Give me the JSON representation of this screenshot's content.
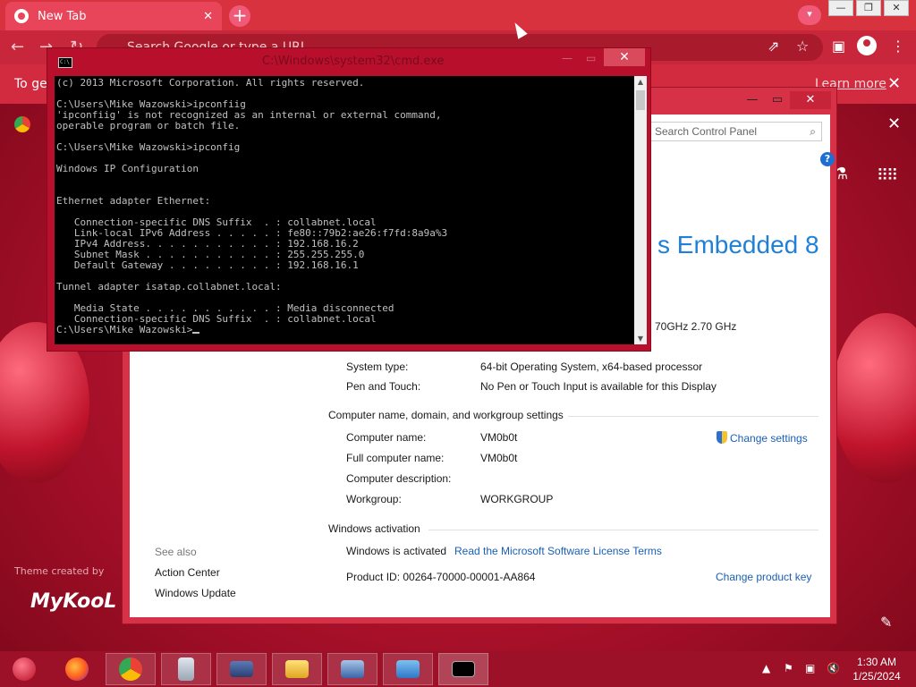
{
  "browser": {
    "tab_title": "New Tab",
    "tab_close": "✕",
    "new_tab": "+",
    "omnibox_placeholder": "Search Google or type a URL",
    "infobar_text": "To get",
    "learn_more": "Learn more",
    "close_glyph": "✕",
    "theme_credit": "Theme created by",
    "brand_text": "MyKooL"
  },
  "syswin": {
    "search_placeholder": "Search Control Panel",
    "help": "?",
    "edition": "s Embedded 8",
    "cpu": "70GHz   2.70 GHz",
    "rows_system": [
      {
        "label": "System type:",
        "value": "64-bit Operating System, x64-based processor"
      },
      {
        "label": "Pen and Touch:",
        "value": "No Pen or Touch Input is available for this Display"
      }
    ],
    "section_computer": "Computer name, domain, and workgroup settings",
    "rows_computer": [
      {
        "label": "Computer name:",
        "value": "VM0b0t"
      },
      {
        "label": "Full computer name:",
        "value": "VM0b0t"
      },
      {
        "label": "Computer description:",
        "value": ""
      },
      {
        "label": "Workgroup:",
        "value": "WORKGROUP"
      }
    ],
    "change_settings": "Change settings",
    "section_activation": "Windows activation",
    "activated": "Windows is activated",
    "license_link": "Read the Microsoft Software License Terms",
    "product_id": "Product ID:  00264-70000-00001-AA864",
    "change_key": "Change product key",
    "see_also": "See also",
    "see_also_items": [
      "Action Center",
      "Windows Update"
    ]
  },
  "cmd": {
    "title": "C:\\Windows\\system32\\cmd.exe",
    "output": "(c) 2013 Microsoft Corporation. All rights reserved.\n\nC:\\Users\\Mike Wazowski>ipconfiig\n'ipconfiig' is not recognized as an internal or external command,\noperable program or batch file.\n\nC:\\Users\\Mike Wazowski>ipconfig\n\nWindows IP Configuration\n\n\nEthernet adapter Ethernet:\n\n   Connection-specific DNS Suffix  . : collabnet.local\n   Link-local IPv6 Address . . . . . : fe80::79b2:ae26:f7fd:8a9a%3\n   IPv4 Address. . . . . . . . . . . : 192.168.16.2\n   Subnet Mask . . . . . . . . . . . : 255.255.255.0\n   Default Gateway . . . . . . . . . : 192.168.16.1\n\nTunnel adapter isatap.collabnet.local:\n\n   Media State . . . . . . . . . . . : Media disconnected\n   Connection-specific DNS Suffix  . : collabnet.local\n",
    "prompt": "C:\\Users\\Mike Wazowski>"
  },
  "taskbar": {
    "time": "1:30 AM",
    "date": "1/25/2024"
  },
  "colors": {
    "accent": "#d8323f",
    "window_frame": "#d73148",
    "link": "#1a5fb4",
    "edition_blue": "#1f80d8",
    "taskbar": "#9c1028"
  }
}
